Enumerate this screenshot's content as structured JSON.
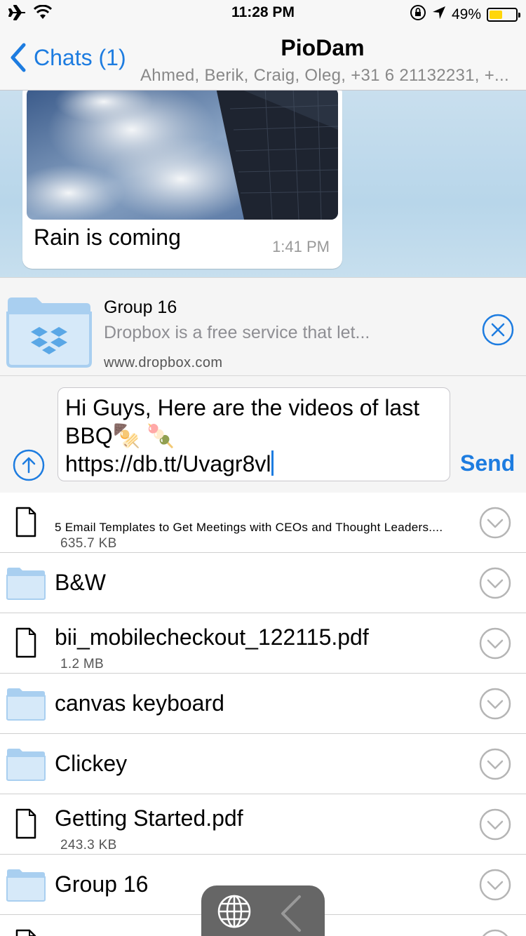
{
  "status_bar": {
    "time": "11:28 PM",
    "battery_percent": "49%",
    "battery_level": 0.49,
    "icons": [
      "airplane-mode-icon",
      "wifi-icon",
      "orientation-lock-icon",
      "location-arrow-icon",
      "battery-icon"
    ]
  },
  "nav": {
    "back_label": "Chats (1)",
    "title": "PioDam",
    "subtitle": "Ahmed, Berik, Craig, Oleg, +31 6 21132231, +..."
  },
  "message": {
    "caption": "Rain is coming",
    "time": "1:41 PM"
  },
  "link_preview": {
    "title": "Group 16",
    "description": "Dropbox is a free service that let...",
    "url": "www.dropbox.com"
  },
  "composer": {
    "text": "Hi Guys, Here are the videos of last\nBBQ🍢 🍡\nhttps://db.tt/Uvagr8vl",
    "send_label": "Send"
  },
  "files": [
    {
      "name": "5 Email Templates to Get Meetings with CEOs and Thought Leaders....",
      "size": "635.7 KB",
      "kind": "file"
    },
    {
      "name": "B&W",
      "size": "",
      "kind": "folder"
    },
    {
      "name": "bii_mobilecheckout_122115.pdf",
      "size": "1.2 MB",
      "kind": "file"
    },
    {
      "name": "canvas keyboard",
      "size": "",
      "kind": "folder"
    },
    {
      "name": "Clickey",
      "size": "",
      "kind": "folder"
    },
    {
      "name": "Getting Started.pdf",
      "size": "243.3 KB",
      "kind": "file"
    },
    {
      "name": "Group 16",
      "size": "",
      "kind": "folder"
    }
  ],
  "colors": {
    "accent": "#1d7ce0",
    "folder": "#a9cff0",
    "battery": "#ffd60a"
  }
}
